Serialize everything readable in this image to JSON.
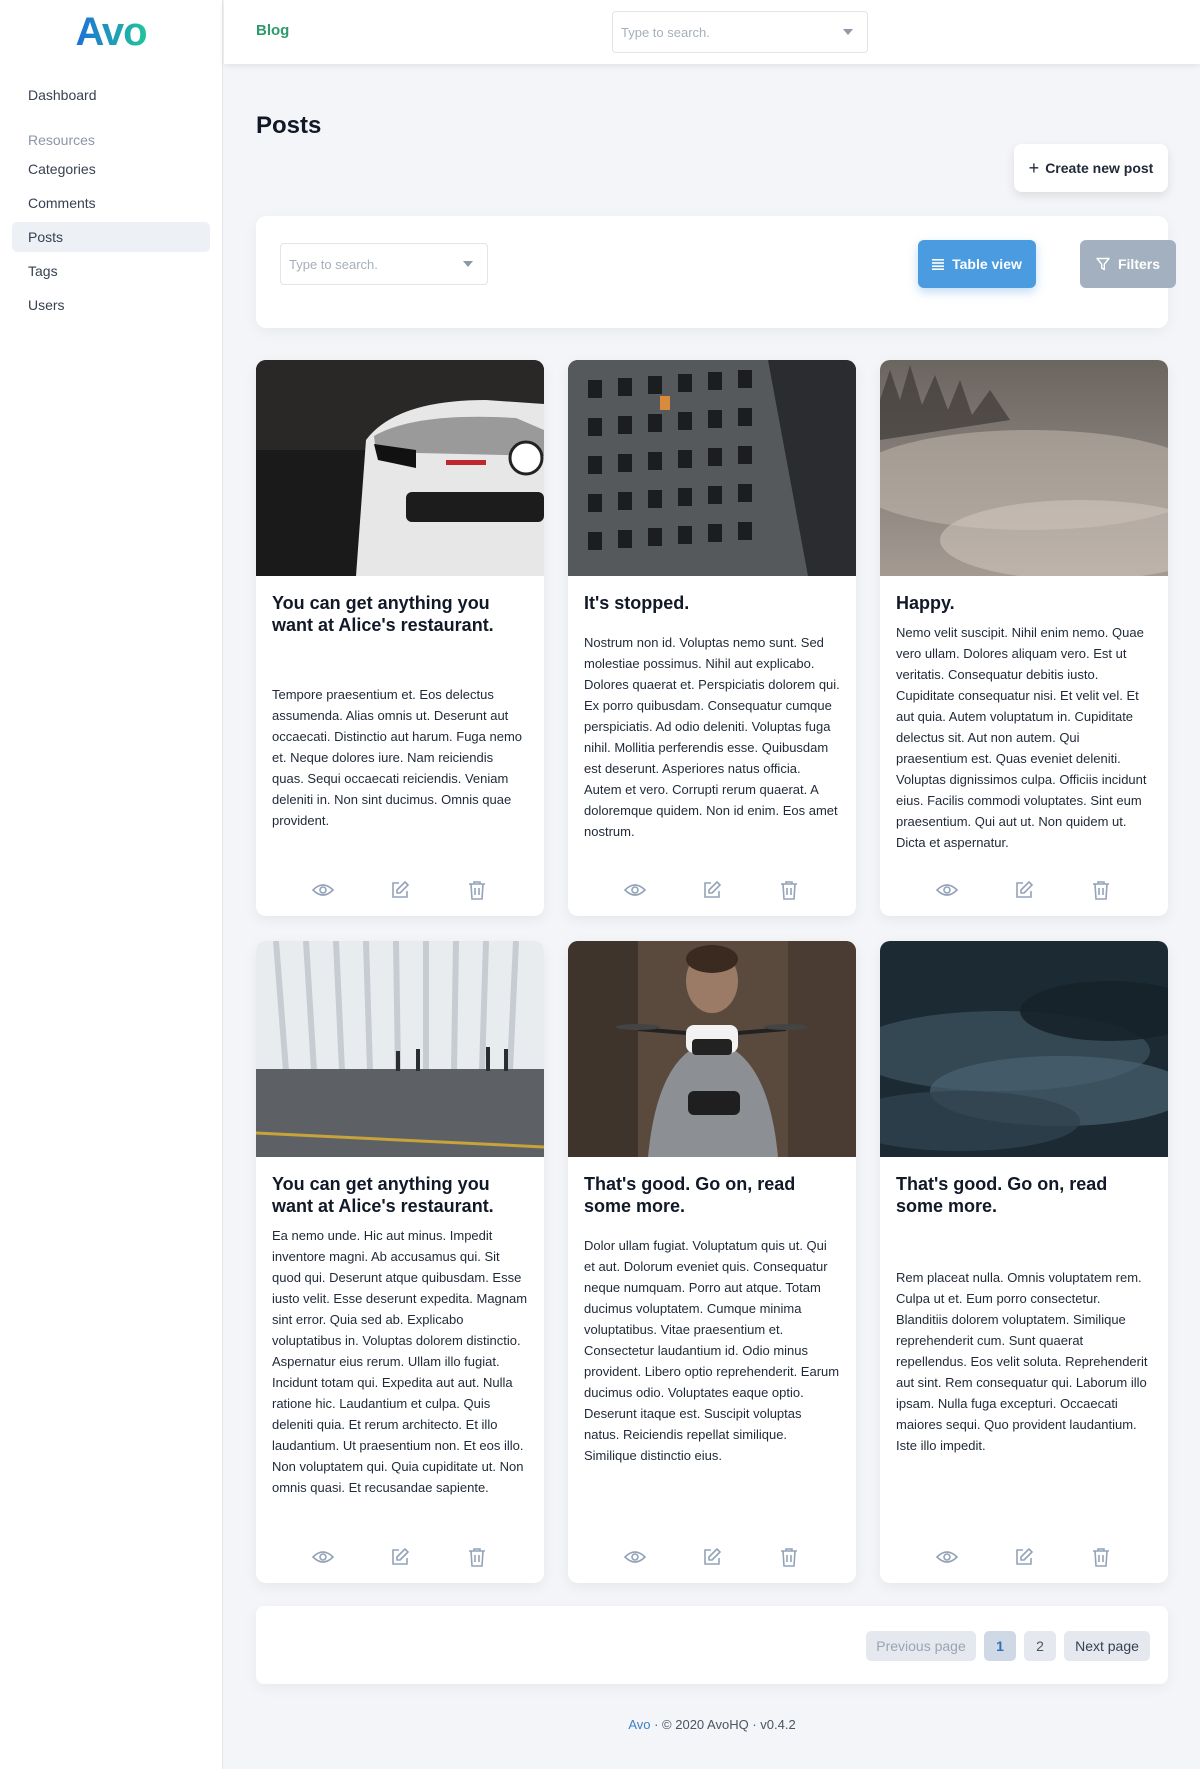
{
  "app": {
    "logo": "Avo"
  },
  "sidebar": {
    "dashboard": "Dashboard",
    "section": "Resources",
    "items": [
      {
        "label": "Categories"
      },
      {
        "label": "Comments"
      },
      {
        "label": "Posts"
      },
      {
        "label": "Tags"
      },
      {
        "label": "Users"
      }
    ]
  },
  "topbar": {
    "breadcrumb": "Blog",
    "search_placeholder": "Type to search."
  },
  "main": {
    "title": "Posts",
    "create_label": "Create new post",
    "search_placeholder": "Type to search.",
    "table_view_label": "Table view",
    "filters_label": "Filters"
  },
  "posts": [
    {
      "title": "You can get anything you want at Alice's restaurant.",
      "body": "Tempore praesentium et. Eos delectus assumenda. Alias omnis ut. Deserunt aut occaecati. Distinctio aut harum. Fuga nemo et. Neque dolores iure. Nam reiciendis quas. Sequi occaecati reiciendis. Veniam deleniti in. Non sint ducimus. Omnis quae provident."
    },
    {
      "title": "It's stopped.",
      "body": "Nostrum non id. Voluptas nemo sunt. Sed molestiae possimus. Nihil aut explicabo. Dolores quaerat et. Perspiciatis dolorem qui. Ex porro quibusdam. Consequatur cumque perspiciatis. Ad odio deleniti. Voluptas fuga nihil. Mollitia perferendis esse. Quibusdam est deserunt. Asperiores natus officia. Autem et vero. Corrupti rerum quaerat. A doloremque quidem. Non id enim. Eos amet nostrum."
    },
    {
      "title": "Happy.",
      "body": "Nemo velit suscipit. Nihil enim nemo. Quae vero ullam. Dolores aliquam vero. Est ut veritatis. Consequatur debitis iusto. Cupiditate consequatur nisi. Et velit vel. Et aut quia. Autem voluptatum in. Cupiditate delectus sit. Aut non autem. Qui praesentium est. Quas eveniet deleniti. Voluptas dignissimos culpa. Officiis incidunt eius. Facilis commodi voluptates. Sint eum praesentium. Qui aut ut. Non quidem ut. Dicta et aspernatur."
    },
    {
      "title": "You can get anything you want at Alice's restaurant.",
      "body": "Ea nemo unde. Hic aut minus. Impedit inventore magni. Ab accusamus qui. Sit quod qui. Deserunt atque quibusdam. Esse iusto velit. Esse deserunt expedita. Magnam sint error. Quia sed ab. Explicabo voluptatibus in. Voluptas dolorem distinctio. Aspernatur eius rerum. Ullam illo fugiat. Incidunt totam qui. Expedita aut aut. Nulla ratione hic. Laudantium et culpa. Quis deleniti quia. Et rerum architecto. Et illo laudantium. Ut praesentium non. Et eos illo. Non voluptatem qui. Quia cupiditate ut. Non omnis quasi. Et recusandae sapiente."
    },
    {
      "title": "That's good. Go on, read some more.",
      "body": "Dolor ullam fugiat. Voluptatum quis ut. Qui et aut. Dolorum eveniet quis. Consequatur neque numquam. Porro aut atque. Totam ducimus voluptatem. Cumque minima voluptatibus. Vitae praesentium et. Consectetur laudantium id. Odio minus provident. Libero optio reprehenderit. Earum ducimus odio. Voluptates eaque optio. Deserunt itaque est. Suscipit voluptas natus. Reiciendis repellat similique. Similique distinctio eius."
    },
    {
      "title": "That's good. Go on, read some more.",
      "body": "Rem placeat nulla. Omnis voluptatem rem. Culpa ut et. Eum porro consectetur. Blanditiis dolorem voluptatem. Similique reprehenderit cum. Sunt quaerat repellendus. Eos velit soluta. Reprehenderit aut sint. Rem consequatur qui. Laborum illo ipsam. Nulla fuga excepturi. Occaecati maiores sequi. Quo provident laudantium. Iste illo impedit."
    }
  ],
  "pagination": {
    "previous": "Previous page",
    "page1": "1",
    "page2": "2",
    "next": "Next page"
  },
  "footer": {
    "brand": "Avo",
    "text": " · © 2020 AvoHQ · v0.4.2"
  }
}
